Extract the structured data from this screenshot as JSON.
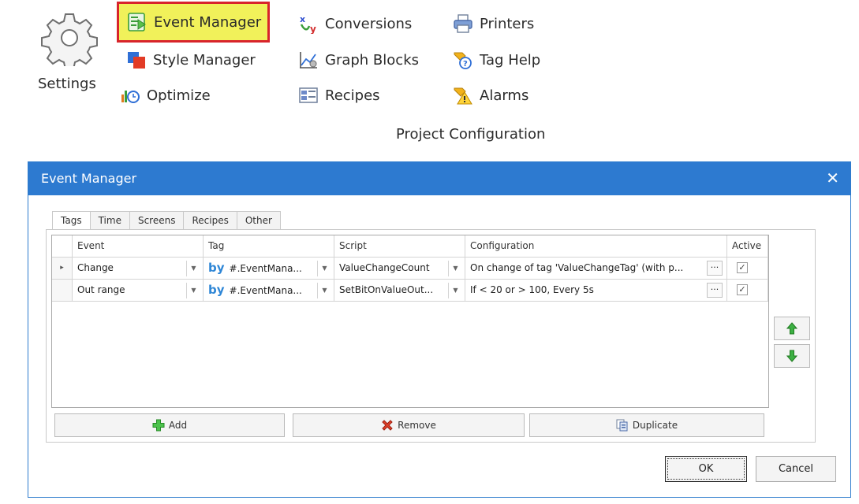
{
  "ribbon": {
    "settings_label": "Settings",
    "group_label": "Project Configuration",
    "buttons": [
      {
        "label": "Event Manager",
        "icon": "event-manager-icon"
      },
      {
        "label": "Style Manager",
        "icon": "style-manager-icon"
      },
      {
        "label": "Optimize",
        "icon": "optimize-icon"
      },
      {
        "label": "Conversions",
        "icon": "conversions-icon"
      },
      {
        "label": "Graph Blocks",
        "icon": "graph-blocks-icon"
      },
      {
        "label": "Recipes",
        "icon": "recipes-icon"
      },
      {
        "label": "Printers",
        "icon": "printer-icon"
      },
      {
        "label": "Tag Help",
        "icon": "tag-help-icon"
      },
      {
        "label": "Alarms",
        "icon": "alarms-icon"
      }
    ]
  },
  "dialog": {
    "title": "Event Manager",
    "close_symbol": "✕",
    "tabs": [
      "Tags",
      "Time",
      "Screens",
      "Recipes",
      "Other"
    ],
    "active_tab": "Tags",
    "columns": [
      "Event",
      "Tag",
      "Script",
      "Configuration",
      "Active"
    ],
    "rows": [
      {
        "event": "Change",
        "tag_prefix": "by",
        "tag": "#.EventMana...",
        "script": "ValueChangeCount",
        "configuration": "On change of tag 'ValueChangeTag' (with p...",
        "active": true,
        "current": true
      },
      {
        "event": "Out range",
        "tag_prefix": "by",
        "tag": "#.EventMana...",
        "script": "SetBitOnValueOut...",
        "configuration": "If < 20 or > 100, Every 5s",
        "active": true,
        "current": false
      }
    ],
    "row_indicator": "▸",
    "dropdown_symbol": "▼",
    "ellipsis_symbol": "···",
    "check_symbol": "✓",
    "actions": {
      "add": "Add",
      "remove": "Remove",
      "duplicate": "Duplicate"
    },
    "ok": "OK",
    "cancel": "Cancel"
  },
  "colors": {
    "accent": "#2d7ad0",
    "highlight_fill": "#f1f15a",
    "highlight_border": "#d8242b",
    "arrow_green": "#3cb043"
  }
}
